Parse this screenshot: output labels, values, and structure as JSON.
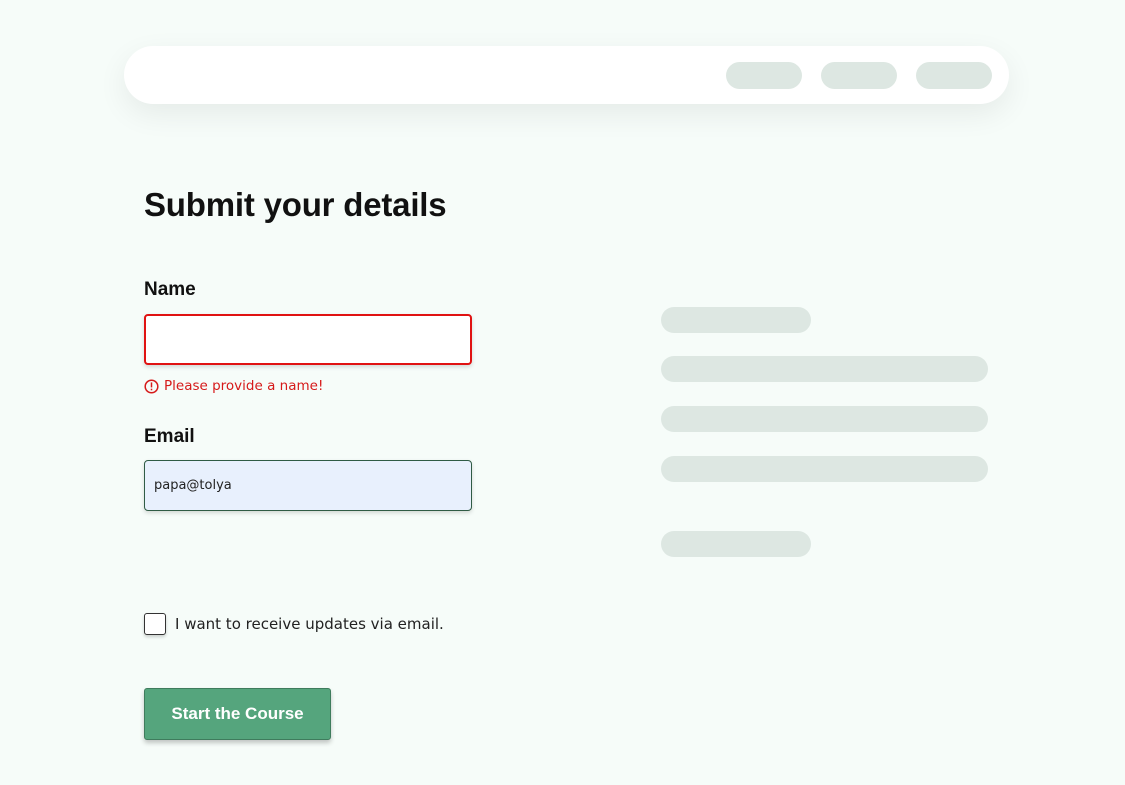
{
  "form": {
    "title": "Submit your details",
    "name_label": "Name",
    "name_value": "",
    "name_error": "Please provide a name!",
    "email_label": "Email",
    "email_value": "papa@tolya",
    "checkbox_label": "I want to receive updates via email.",
    "checkbox_checked": false,
    "submit_label": "Start the Course"
  },
  "icons": {
    "error": "error-circle-icon"
  },
  "colors": {
    "background": "#f6fcf9",
    "accent": "#55a57d",
    "error": "#e01212",
    "placeholder": "#dde7e2",
    "autofill": "#e8f0fd"
  }
}
